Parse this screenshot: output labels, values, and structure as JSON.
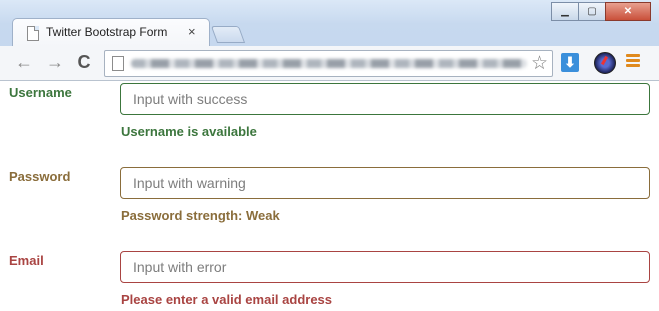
{
  "browser": {
    "tab_title": "Twitter Bootstrap Form",
    "tab_close": "×",
    "window_buttons": {
      "minimize": "▁",
      "maximize": "▢",
      "close": "✕"
    },
    "nav": {
      "back": "←",
      "forward": "→",
      "reload": "C"
    },
    "star": "☆",
    "download": "⬇",
    "icons": [
      "page-icon",
      "star-icon",
      "download-icon",
      "extension-icon",
      "menu-icon"
    ]
  },
  "form": {
    "fields": [
      {
        "label": "Username",
        "placeholder": "Input with success",
        "help": "Username is available",
        "state": "success",
        "color": "#3c763d"
      },
      {
        "label": "Password",
        "placeholder": "Input with warning",
        "help": "Password strength: Weak",
        "state": "warning",
        "color": "#8a6d3b"
      },
      {
        "label": "Email",
        "placeholder": "Input with error",
        "help": "Please enter a valid email address",
        "state": "error",
        "color": "#a94442"
      }
    ]
  }
}
